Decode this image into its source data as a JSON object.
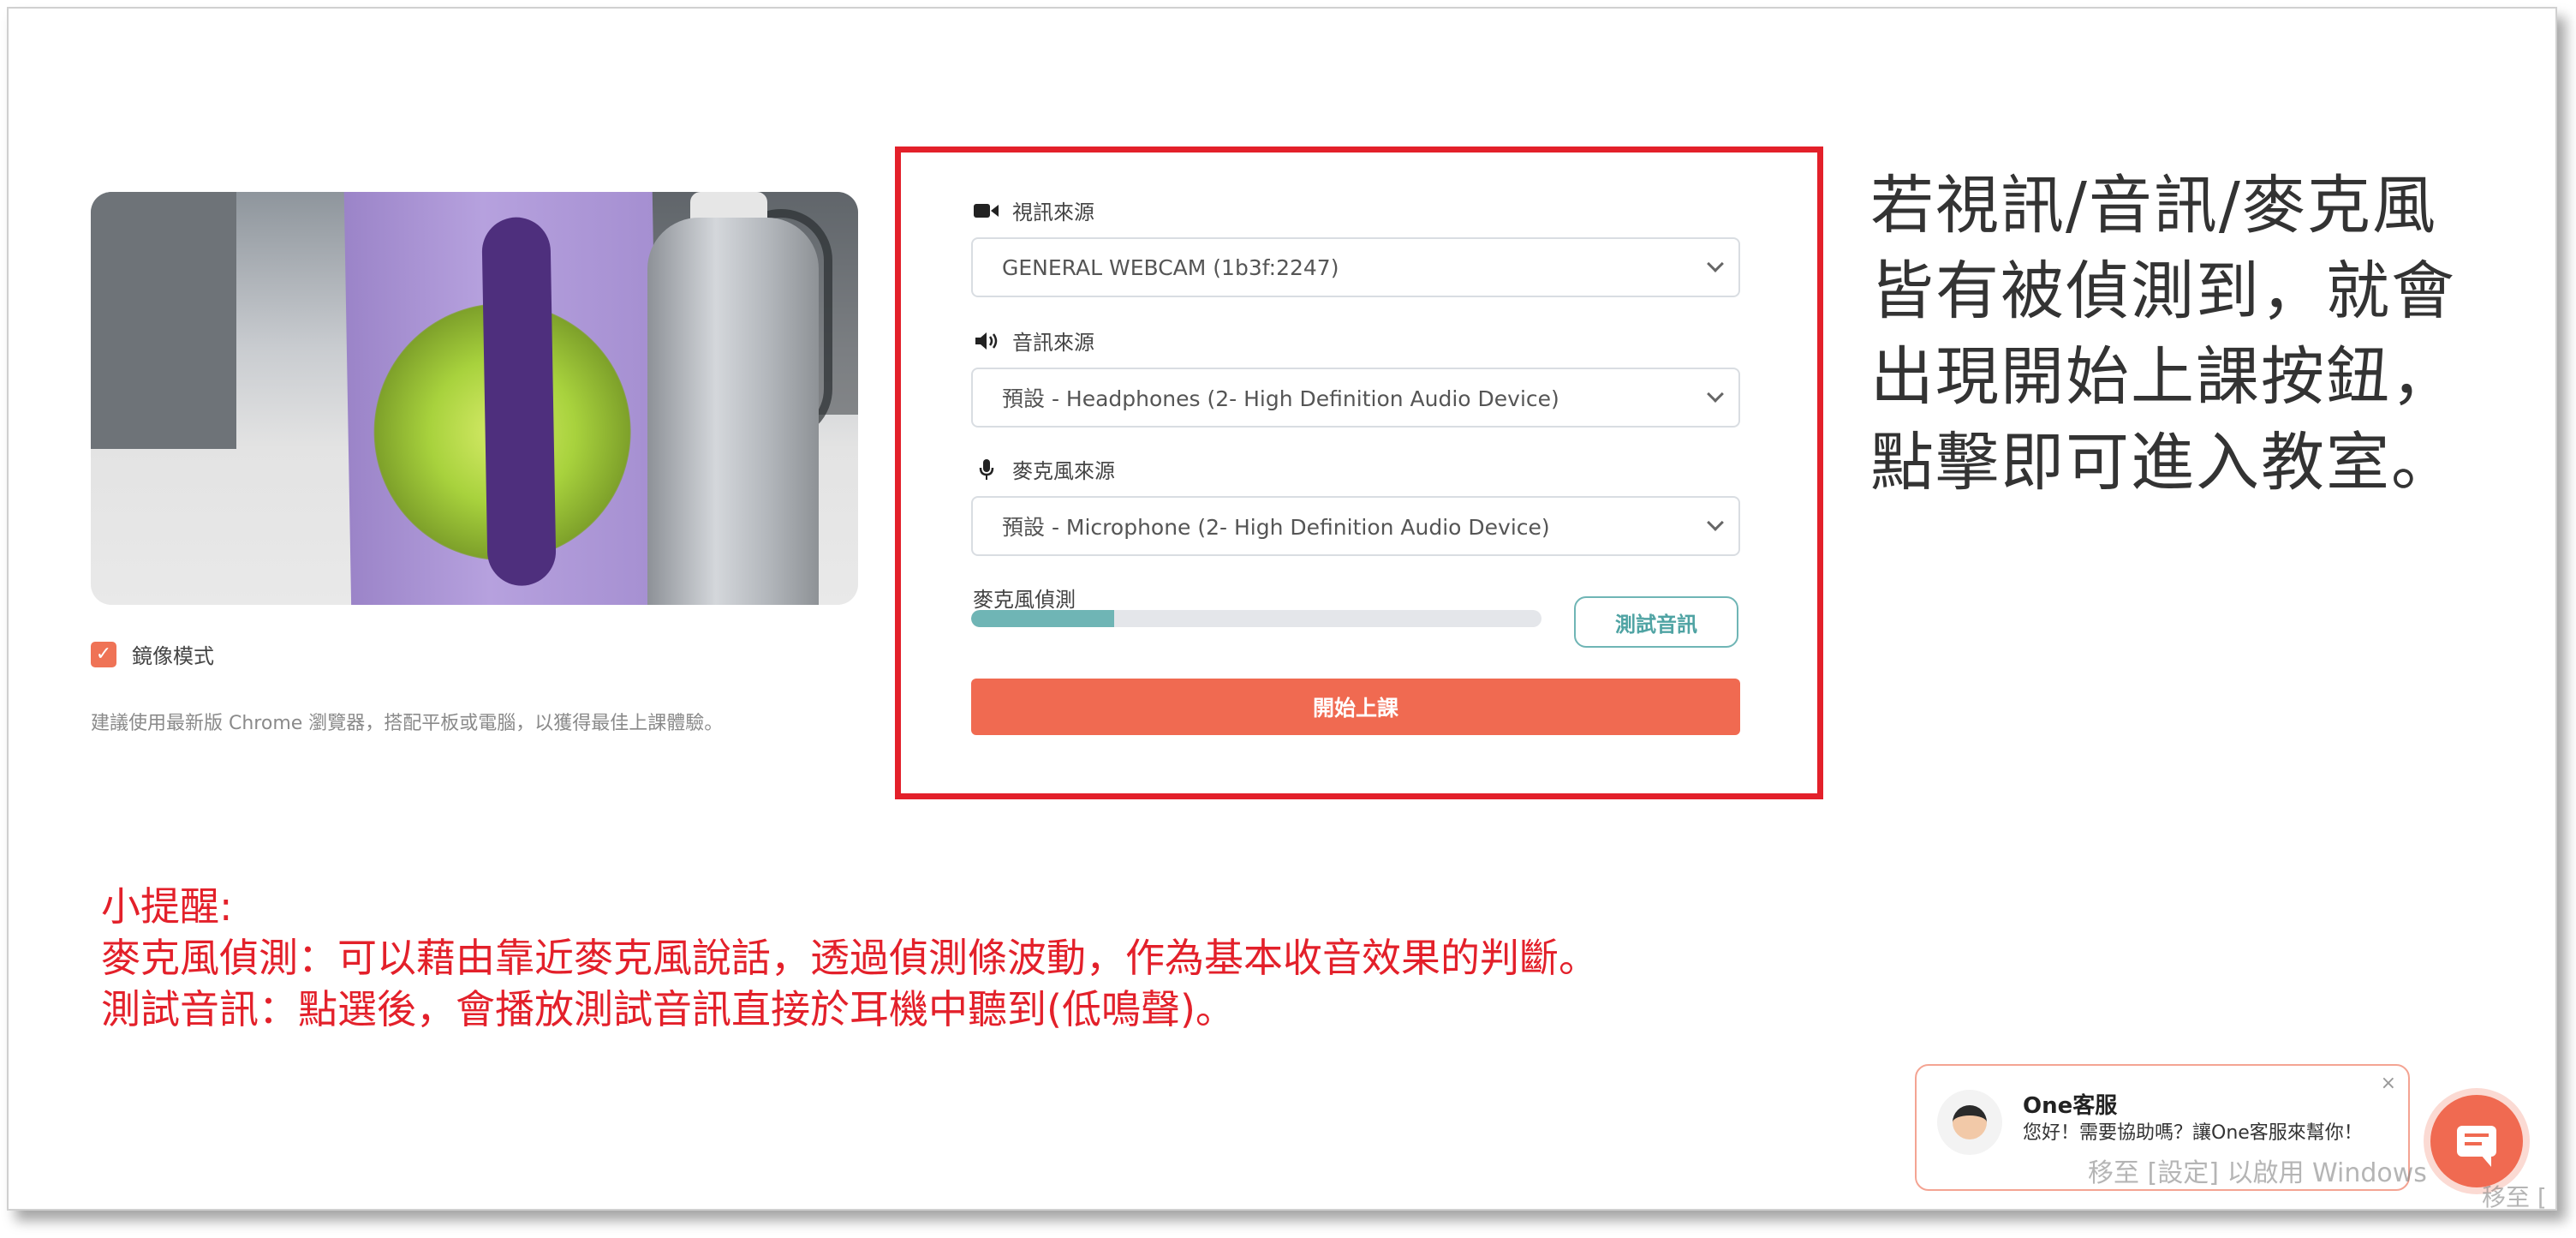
{
  "preview": {
    "mirror_label": "鏡像模式",
    "mirror_checked": true,
    "browser_hint": "建議使用最新版 Chrome 瀏覽器，搭配平板或電腦，以獲得最佳上課體驗。"
  },
  "settings": {
    "video": {
      "label": "視訊來源",
      "icon": "video-camera-icon",
      "value": "GENERAL WEBCAM (1b3f:2247)"
    },
    "audio": {
      "label": "音訊來源",
      "icon": "speaker-icon",
      "value": "預設 - Headphones (2- High Definition Audio Device)"
    },
    "mic": {
      "label": "麥克風來源",
      "icon": "microphone-icon",
      "value": "預設 - Microphone (2- High Definition Audio Device)"
    },
    "mic_test": {
      "label": "麥克風偵測",
      "level": 0.25,
      "button": "測試音訊"
    },
    "start_button": "開始上課"
  },
  "annotation": {
    "lines": [
      "若視訊/音訊/麥克風",
      "皆有被偵測到，就會",
      "出現開始上課按鈕，",
      "點擊即可進入教室。"
    ]
  },
  "notes": {
    "lines": [
      "小提醒:",
      "麥克風偵測：可以藉由靠近麥克風說話，透過偵測條波動，作為基本收音效果的判斷。",
      "測試音訊：點選後，會播放測試音訊直接於耳機中聽到(低鳴聲)。"
    ]
  },
  "chat": {
    "title": "One客服",
    "message": "您好！需要協助嗎？讓One客服來幫你！",
    "close": "×"
  },
  "watermark": {
    "line1": "移至 [設定] 以啟用 Windows",
    "line2": "移至 ["
  },
  "colors": {
    "accent": "#f06a51",
    "teal": "#6fb5b5",
    "highlight": "#e3202a"
  }
}
